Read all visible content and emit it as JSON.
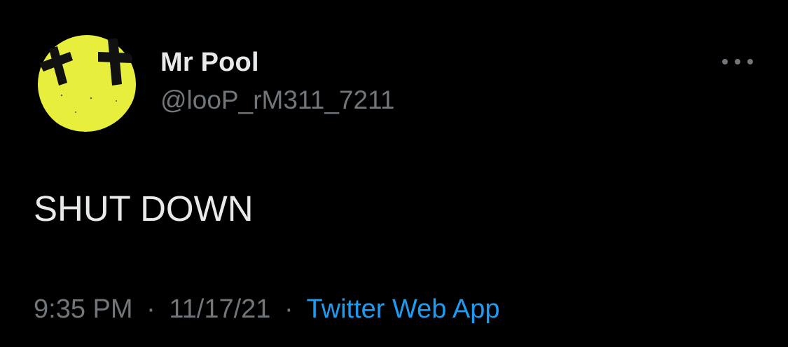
{
  "tweet": {
    "author": {
      "display_name": "Mr Pool",
      "handle": "@looP_rM311_7211",
      "avatar_icon": "yellow-smiley-avatar"
    },
    "more_icon": "more-horizontal-icon",
    "text": "SHUT DOWN",
    "meta": {
      "time": "9:35 PM",
      "separator": "·",
      "date": "11/17/21",
      "source": "Twitter Web App"
    }
  },
  "colors": {
    "background": "#000000",
    "primary_text": "#e7e9ea",
    "secondary_text": "#71767b",
    "link": "#1d9bf0",
    "avatar_yellow": "#e8ee3c"
  }
}
